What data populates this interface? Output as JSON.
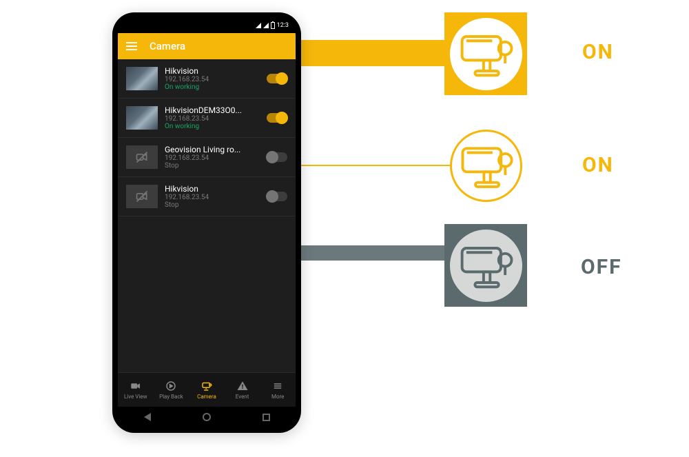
{
  "statusbar": {
    "time": "12:3"
  },
  "appbar": {
    "title": "Camera"
  },
  "cameras": [
    {
      "name": "Hikvision",
      "ip": "192.168.23.54",
      "status": "On working",
      "on": true
    },
    {
      "name": "HikvisionDEM33O0...",
      "ip": "192.168.23.54",
      "status": "On working",
      "on": true
    },
    {
      "name": "Geovision Living ro...",
      "ip": "192.168.23.54",
      "status": "Stop",
      "on": false
    },
    {
      "name": "Hikvision",
      "ip": "192.168.23.54",
      "status": "Stop",
      "on": false
    }
  ],
  "nav": {
    "liveview": "Live View",
    "playback": "Play Back",
    "camera": "Camera",
    "event": "Event",
    "more": "More"
  },
  "callouts": {
    "on": "ON",
    "off": "OFF"
  }
}
